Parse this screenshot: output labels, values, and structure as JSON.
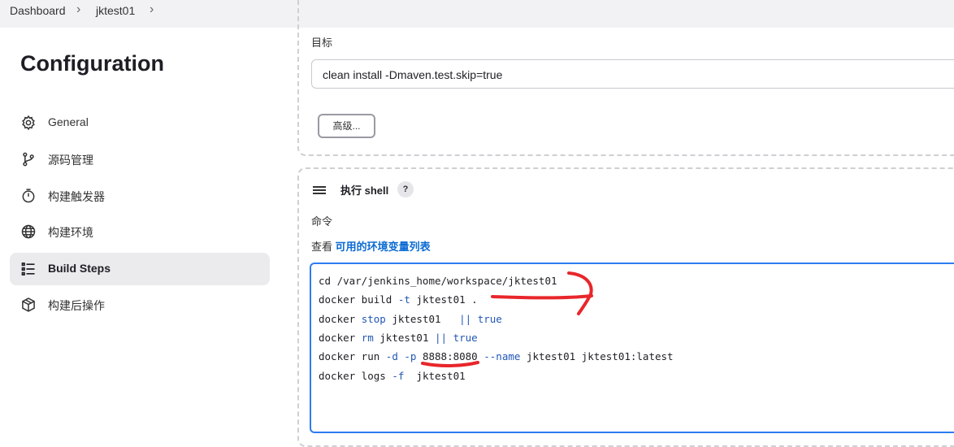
{
  "breadcrumb": {
    "items": [
      "Dashboard",
      "jktest01"
    ],
    "separator": "›"
  },
  "page": {
    "title": "Configuration"
  },
  "sidebar": {
    "items": [
      {
        "label": "General",
        "icon": "gear-icon",
        "active": false
      },
      {
        "label": "源码管理",
        "icon": "branch-icon",
        "active": false
      },
      {
        "label": "构建触发器",
        "icon": "timer-icon",
        "active": false
      },
      {
        "label": "构建环境",
        "icon": "globe-icon",
        "active": false
      },
      {
        "label": "Build Steps",
        "icon": "list-icon",
        "active": true
      },
      {
        "label": "构建后操作",
        "icon": "package-icon",
        "active": false
      }
    ]
  },
  "maven_step": {
    "goal_label": "目标",
    "goal_value": "clean install -Dmaven.test.skip=true",
    "advanced_button": "高级..."
  },
  "shell_step": {
    "title": "执行 shell",
    "help": "?",
    "command_label": "命令",
    "env_prefix": "查看",
    "env_link": "可用的环境变量列表",
    "code_lines": [
      "cd /var/jenkins_home/workspace/jktest01",
      "docker build -t jktest01 .",
      "docker stop jktest01   || true",
      "docker rm jktest01 || true",
      "docker run -d -p 8888:8080 --name jktest01 jktest01:latest",
      "docker logs -f  jktest01"
    ]
  },
  "colors": {
    "accent": "#2d7cf0",
    "link": "#0b6bd3",
    "keyword": "#2257b5",
    "annotation": "#e8262b",
    "nav_active_bg": "#ebebee"
  }
}
